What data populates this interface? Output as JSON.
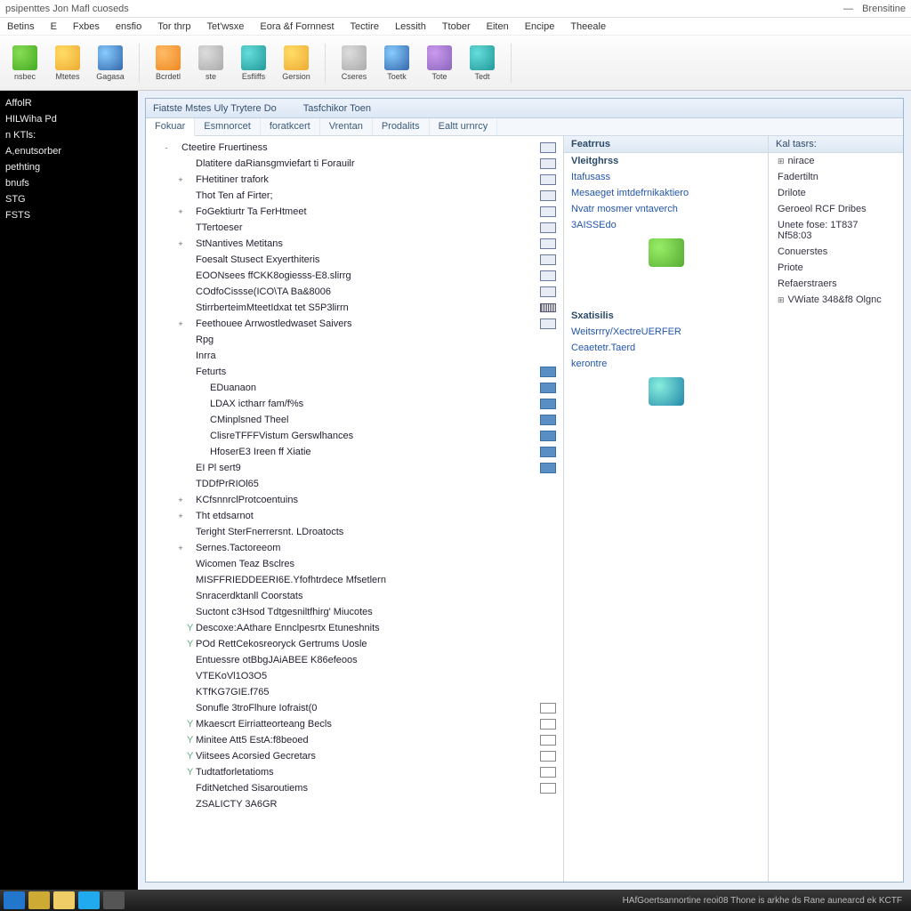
{
  "title": "psipenttes Jon Mafl cuoseds",
  "title_right": "Brensitine",
  "menu": [
    "Betins",
    "E",
    "Fxbes",
    "ensfio",
    "Tor thrp",
    "Tet'wsxe",
    "Eora &f Fornnest",
    "Tectire",
    "Lessith",
    "Ttober",
    "Eiten",
    "Encipe",
    "Theeale"
  ],
  "toolbar": [
    {
      "label": "nsbec",
      "color": "green"
    },
    {
      "label": "Mtetes",
      "color": "yellow"
    },
    {
      "label": "Gagasa",
      "color": "blue"
    },
    {
      "label": "Bcrdetl",
      "color": "orange"
    },
    {
      "label": "ste",
      "color": "gray"
    },
    {
      "label": "Esfliffs",
      "color": "teal"
    },
    {
      "label": "Gersion",
      "color": "yellow"
    },
    {
      "label": "Cseres",
      "color": "gray"
    },
    {
      "label": "Toetk",
      "color": "blue"
    },
    {
      "label": "Tote",
      "color": "purple"
    },
    {
      "label": "Tedt",
      "color": "teal"
    }
  ],
  "left_nav": [
    "AffolR",
    "HILWiha Pd",
    "n KTls:",
    "A,enutsorber",
    "pethting",
    "bnufs",
    "STG",
    "FSTS"
  ],
  "frame_header": [
    "Fiatste Mstes Uly Trytere Do",
    "Tasfchikor Toen"
  ],
  "sub_tabs": [
    "Fokuar",
    "Esmnorcet",
    "foratkcert",
    "Vrentan",
    "Prodalits",
    "Ealtt urnrcy"
  ],
  "tree": [
    {
      "t": "Cteetire Fruertiness",
      "p": 1,
      "e": "-",
      "b": "box"
    },
    {
      "t": "Dlatitere daRiansgmviefart ti Forauilr",
      "p": 2,
      "b": "box"
    },
    {
      "t": "FHetitiner trafork",
      "p": 2,
      "e": "+",
      "b": "box"
    },
    {
      "t": "Thot Ten af Firter;",
      "p": 2,
      "b": "box"
    },
    {
      "t": "FoGektiurtr Ta FerHtmeet",
      "p": 2,
      "e": "+",
      "b": "box"
    },
    {
      "t": "TTertoeser",
      "p": 2,
      "b": "box"
    },
    {
      "t": "StNantives Metitans",
      "p": 2,
      "e": "+",
      "b": "box"
    },
    {
      "t": "Foesalt Stusect Exyerthiteris",
      "p": 2,
      "b": "box"
    },
    {
      "t": "EOONsees ffCKK8ogiesss-E8.slirrg",
      "p": 2,
      "b": "box"
    },
    {
      "t": "COdfoCissse(ICO\\TA Ba&8006",
      "p": 2,
      "b": "box"
    },
    {
      "t": "StirrberteimMteetIdxat tet S5P3lirrn",
      "p": 2,
      "b": "bar"
    },
    {
      "t": "Feethouee Arrwostledwaset Saivers",
      "p": 2,
      "e": "+",
      "b": "box"
    },
    {
      "t": "Rpg",
      "p": 2
    },
    {
      "t": "Inrra",
      "p": 2
    },
    {
      "t": "Feturts",
      "p": 2,
      "b": "srv"
    },
    {
      "t": "EDuanaon",
      "p": 3,
      "b": "srv"
    },
    {
      "t": "LDAX ictharr fam/f%s",
      "p": 3,
      "b": "srv"
    },
    {
      "t": "CMinplsned Theel",
      "p": 3,
      "b": "srv"
    },
    {
      "t": "ClisreTFFFVistum Gerswlhances",
      "p": 3,
      "b": "srv"
    },
    {
      "t": "HfoserE3 Ireen ff Xiatie",
      "p": 3,
      "b": "srv"
    },
    {
      "t": "EI Pl sert9",
      "p": 2,
      "b": "srv"
    },
    {
      "t": "TDDfPrRIOl65",
      "p": 2
    },
    {
      "t": "KCfsnnrclProtcoentuins",
      "p": 2,
      "e": "+"
    },
    {
      "t": "Tht etdsarnot",
      "p": 2,
      "e": "+"
    },
    {
      "t": "Teright SterFnerrersnt. LDroatocts",
      "p": 2
    },
    {
      "t": "Sernes.Tactoreeom",
      "p": 2,
      "e": "+"
    },
    {
      "t": "Wicomen Teaz Bsclres",
      "p": 2
    },
    {
      "t": "MISFFRIEDDEERI6E.Yfofhtrdece Mfsetlern",
      "p": 2
    },
    {
      "t": "Snracerdktanll Coorstats",
      "p": 2
    },
    {
      "t": "Suctont c3Hsod Tdtgesniltfhirg' Miucotes",
      "p": 2
    },
    {
      "t": "Descoxe:AAthare Ennclpesrtx Etuneshnits",
      "p": 2,
      "y": true
    },
    {
      "t": "POd RettCekosreoryck Gertrums Uosle",
      "p": 2,
      "y": true
    },
    {
      "t": "Entuessre otBbgJAiABEE K86efeoos",
      "p": 2
    },
    {
      "t": "VTEKoVl1O3O5",
      "p": 2
    },
    {
      "t": "KTfKG7GIE.f765",
      "p": 2
    },
    {
      "t": "Sonufle 3troFlhure Iofraist(0",
      "p": 2,
      "b": "chk"
    },
    {
      "t": "Mkaescrt Eirriatteorteang Becls",
      "p": 2,
      "y": true,
      "b": "chk"
    },
    {
      "t": "Minitee Att5 EstA:f8beoed",
      "p": 2,
      "y": true,
      "b": "chk"
    },
    {
      "t": "Viitsees Acorsied Gecretars",
      "p": 2,
      "y": true,
      "b": "chk"
    },
    {
      "t": "Tudtatforletatioms",
      "p": 2,
      "y": true,
      "b": "chk"
    },
    {
      "t": "FditNetched Sisaroutiems",
      "p": 2,
      "b": "chk"
    },
    {
      "t": "ZSALICTY 3A6GR",
      "p": 2
    }
  ],
  "mid": {
    "h1": "Featrrus",
    "sect1_h": "Vleitghrss",
    "sect1": [
      "Itafusass",
      "Mesaeget imtdefrnikaktiero",
      "Nvatr mosmer vntaverch",
      "3AISSEdo"
    ],
    "sect2_h": "Sxatisilis",
    "sect2": [
      "Weitsrrry/XectreUERFER",
      "Ceaetetr.Taerd",
      "kerontre"
    ]
  },
  "right": {
    "h": "Kal tasrs:",
    "items": [
      {
        "t": "nirace",
        "e": "+"
      },
      {
        "t": "Fadertiltn"
      },
      {
        "t": "Drilote"
      },
      {
        "t": "Geroeol RCF Dribes"
      },
      {
        "t": "Unete fose:  1T837 Nf58:03"
      },
      {
        "t": "Conuerstes"
      },
      {
        "t": "Priote"
      },
      {
        "t": "Refaerstraers"
      },
      {
        "t": "VWiate 348&f8 Olgnc",
        "e": "+"
      }
    ]
  },
  "footer": "HAfGoertsannortine reoi08  Thone is arkhe ds   Rane aunearcd ek KCTF"
}
